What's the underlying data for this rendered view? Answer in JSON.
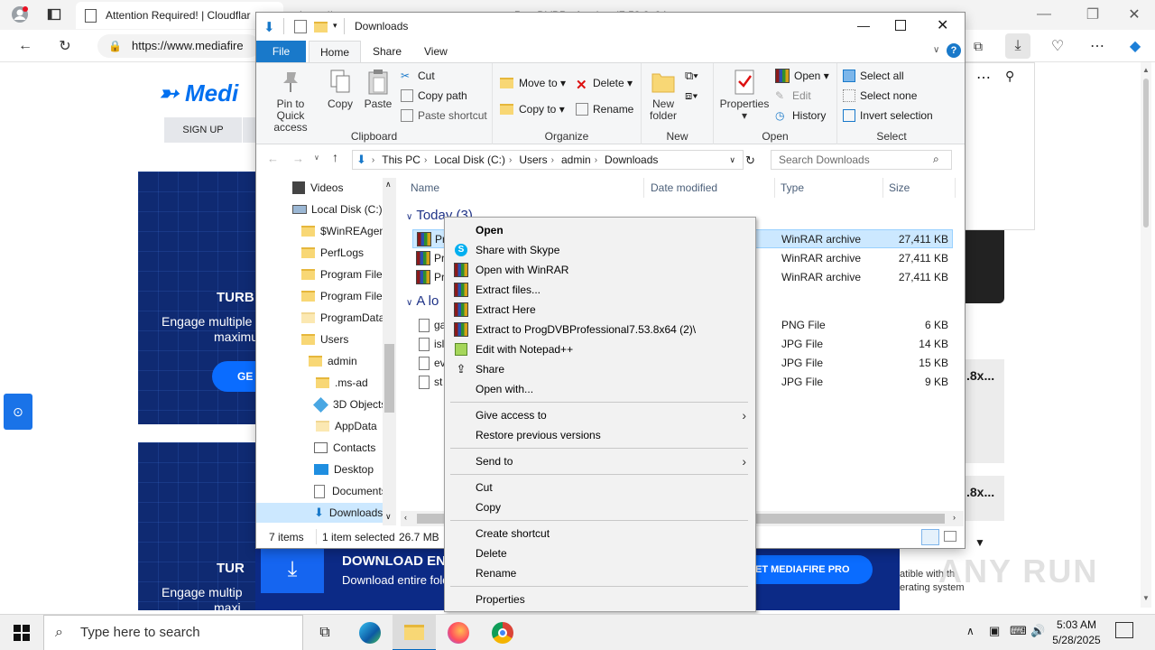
{
  "browser": {
    "tabs": [
      {
        "label": "Attention Required! | Cloudflar"
      },
      {
        "label": "https://..."
      },
      {
        "label": "ProgDVBProfessional7.53.8x64..."
      }
    ],
    "url": "https://www.mediafire",
    "colors": {
      "accent": "#0067c0"
    }
  },
  "mediafire": {
    "logo": "Medi",
    "signup": "SIGN UP",
    "promo1": {
      "title": "TURB",
      "sub_line1": "Engage multiple",
      "sub_line2": "maximu",
      "button": "GE"
    },
    "promo2": {
      "title": "TUR",
      "sub_line1": "Engage multip",
      "sub_line2": "maxi"
    },
    "bottom_banner": {
      "title": "DOWNLOAD EN",
      "sub": "Download entire fold",
      "button": "GET MEDIAFIRE PRO",
      "right_line1": "atible with th",
      "right_line2": "erating system"
    },
    "right_file1": ".8x...",
    "right_file2": ".8x..."
  },
  "explorer": {
    "title": "Downloads",
    "ribbon_tabs": [
      "File",
      "Home",
      "Share",
      "View"
    ],
    "clipboard": {
      "pin": "Pin to Quick access",
      "copy": "Copy",
      "paste": "Paste",
      "cut": "Cut",
      "copy_path": "Copy path",
      "paste_shortcut": "Paste shortcut",
      "label": "Clipboard"
    },
    "organize": {
      "move_to": "Move to",
      "delete": "Delete",
      "copy_to": "Copy to",
      "rename": "Rename",
      "label": "Organize"
    },
    "new": {
      "new_folder": "New folder",
      "label": "New"
    },
    "open": {
      "properties": "Properties",
      "open": "Open",
      "edit": "Edit",
      "history": "History",
      "label": "Open"
    },
    "select": {
      "select_all": "Select all",
      "select_none": "Select none",
      "invert": "Invert selection",
      "label": "Select"
    },
    "breadcrumb": [
      "This PC",
      "Local Disk (C:)",
      "Users",
      "admin",
      "Downloads"
    ],
    "search_placeholder": "Search Downloads",
    "nav": [
      {
        "label": "Videos"
      },
      {
        "label": "Local Disk (C:)"
      },
      {
        "label": "$WinREAgent"
      },
      {
        "label": "PerfLogs"
      },
      {
        "label": "Program Files"
      },
      {
        "label": "Program Files"
      },
      {
        "label": "ProgramData"
      },
      {
        "label": "Users"
      },
      {
        "label": "admin"
      },
      {
        "label": ".ms-ad"
      },
      {
        "label": "3D Objects"
      },
      {
        "label": "AppData"
      },
      {
        "label": "Contacts"
      },
      {
        "label": "Desktop"
      },
      {
        "label": "Documents"
      },
      {
        "label": "Downloads"
      }
    ],
    "columns": [
      "Name",
      "Date modified",
      "Type",
      "Size"
    ],
    "groups": [
      "Today (3)",
      "A lo"
    ],
    "files_today": [
      {
        "name": "Pr",
        "type": "WinRAR archive",
        "size": "27,411 KB"
      },
      {
        "name": "Pr",
        "type": "WinRAR archive",
        "size": "27,411 KB"
      },
      {
        "name": "Pr",
        "type": "WinRAR archive",
        "size": "27,411 KB"
      }
    ],
    "files_older": [
      {
        "name": "ga",
        "type": "PNG File",
        "size": "6 KB"
      },
      {
        "name": "isl",
        "type": "JPG File",
        "size": "14 KB"
      },
      {
        "name": "ev",
        "type": "JPG File",
        "size": "15 KB"
      },
      {
        "name": "st",
        "type": "JPG File",
        "size": "9 KB"
      }
    ],
    "status": {
      "items": "7 items",
      "selected": "1 item selected",
      "size": "26.7 MB"
    }
  },
  "context_menu": {
    "items": [
      {
        "label": "Open",
        "icon": ""
      },
      {
        "label": "Share with Skype",
        "icon": "skype-icon"
      },
      {
        "label": "Open with WinRAR",
        "icon": "winrar-icon"
      },
      {
        "label": "Extract files...",
        "icon": "winrar-icon"
      },
      {
        "label": "Extract Here",
        "icon": "winrar-icon"
      },
      {
        "label": "Extract to ProgDVBProfessional7.53.8x64 (2)\\",
        "icon": "winrar-icon"
      },
      {
        "label": "Edit with Notepad++",
        "icon": "notepadpp-icon"
      },
      {
        "label": "Share",
        "icon": "share-icon"
      },
      {
        "label": "Open with...",
        "icon": ""
      },
      {
        "label": "Give access to",
        "icon": ""
      },
      {
        "label": "Restore previous versions",
        "icon": ""
      },
      {
        "label": "Send to",
        "icon": ""
      },
      {
        "label": "Cut",
        "icon": ""
      },
      {
        "label": "Copy",
        "icon": ""
      },
      {
        "label": "Create shortcut",
        "icon": ""
      },
      {
        "label": "Delete",
        "icon": ""
      },
      {
        "label": "Rename",
        "icon": ""
      },
      {
        "label": "Properties",
        "icon": ""
      }
    ]
  },
  "taskbar": {
    "search_placeholder": "Type here to search",
    "time": "5:03 AM",
    "date": "5/28/2025"
  },
  "watermark": "ANY RUN"
}
